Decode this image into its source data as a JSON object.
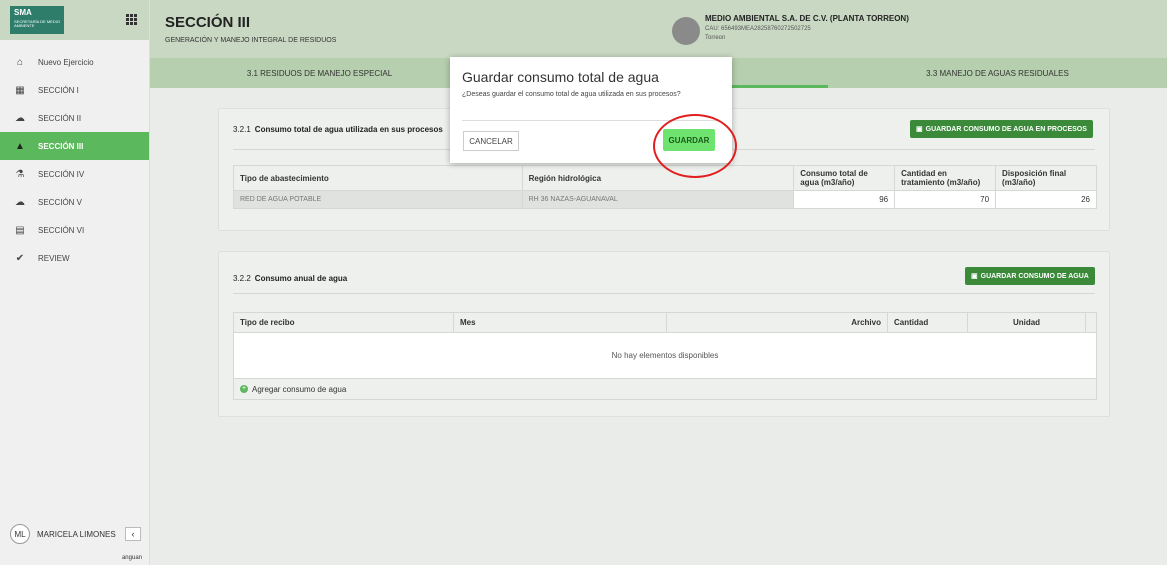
{
  "sidebar": {
    "logo_text": "SMA",
    "logo_sub": "SECRETARÍA DE MEDIO AMBIENTE",
    "items": [
      {
        "label": "Nuevo Ejercicio",
        "icon": "home-icon",
        "glyph": "⌂"
      },
      {
        "label": "SECCIÓN I",
        "icon": "building-icon",
        "glyph": "▦"
      },
      {
        "label": "SECCIÓN II",
        "icon": "factory-icon",
        "glyph": "☁"
      },
      {
        "label": "SECCIÓN III",
        "icon": "warning-icon",
        "glyph": "▲"
      },
      {
        "label": "SECCIÓN IV",
        "icon": "flask-icon",
        "glyph": "⚗"
      },
      {
        "label": "SECCIÓN V",
        "icon": "cloud-icon",
        "glyph": "☁"
      },
      {
        "label": "SECCIÓN VI",
        "icon": "document-icon",
        "glyph": "▤"
      },
      {
        "label": "REVIEW",
        "icon": "check-circle-icon",
        "glyph": "✔"
      }
    ],
    "user_initials": "ML",
    "user_name": "MARICELA LIMONES",
    "collapse_glyph": "‹",
    "footer": "anguan"
  },
  "header": {
    "title": "SECCIÓN III",
    "subtitle": "GENERACIÓN Y MANEJO INTEGRAL DE RESIDUOS",
    "company_name": "MEDIO AMBIENTAL S.A. DE C.V. (PLANTA TORREON)",
    "company_cau": "CAU: 656493MEA28258760272502725",
    "company_city": "Torreon"
  },
  "tabs": [
    {
      "label": "3.1 RESIDUOS DE MANEJO ESPECIAL"
    },
    {
      "label": ""
    },
    {
      "label": "3.3 MANEJO DE AGUAS RESIDUALES"
    }
  ],
  "section1": {
    "number": "3.2.1",
    "title": "Consumo total de agua utilizada en sus procesos",
    "save_button": "GUARDAR CONSUMO DE AGUA EN PROCESOS",
    "columns": [
      "Tipo de abastecimiento",
      "Región hidrológica",
      "Consumo total de agua (m3/año)",
      "Cantidad en tratamiento (m3/año)",
      "Disposición final (m3/año)"
    ],
    "row": {
      "tipo": "RED DE AGUA POTABLE",
      "region": "RH 36 NAZAS-AGUANAVAL",
      "consumo": "96",
      "tratamiento": "70",
      "disposicion": "26"
    }
  },
  "section2": {
    "number": "3.2.2",
    "title": "Consumo anual de agua",
    "save_button": "GUARDAR CONSUMO DE AGUA",
    "columns": [
      "Tipo de recibo",
      "Mes",
      "Archivo",
      "Cantidad",
      "Unidad"
    ],
    "empty_text": "No hay elementos disponibles",
    "add_label": "Agregar consumo de agua"
  },
  "modal": {
    "title": "Guardar consumo total de agua",
    "body": "¿Deseas guardar el consumo total de agua utilizada en sus procesos?",
    "cancel": "CANCELAR",
    "confirm": "GUARDAR"
  },
  "colors": {
    "accent": "#5cb85c",
    "button_dark": "#3a8a3a",
    "header_bg": "#c9d8c3",
    "annotation": "#e02020"
  }
}
